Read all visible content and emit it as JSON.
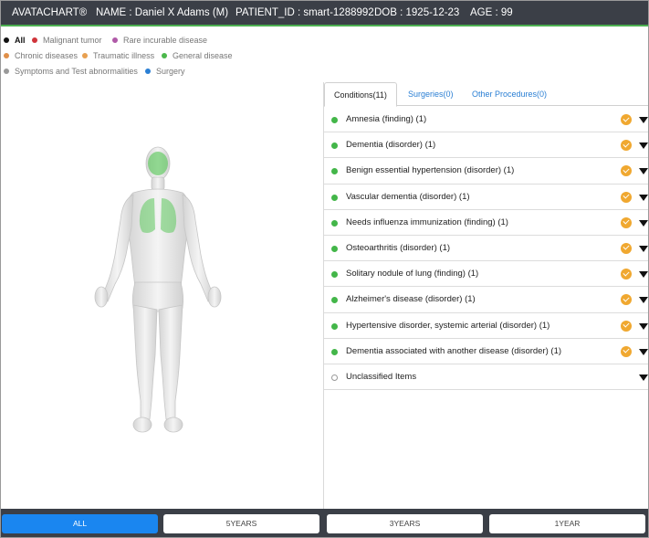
{
  "header": {
    "app_name": "AVATACHART®",
    "name": "NAME : Daniel X Adams (M)",
    "patient_id": "PATIENT_ID : smart-1288992",
    "dob": "DOB : 1925-12-23",
    "age": "AGE : 99",
    "accent_color": "#4caf50"
  },
  "legend": {
    "items": [
      {
        "label": "All",
        "color": "#111111",
        "selected": true
      },
      {
        "label": "Malignant tumor",
        "color": "#d0343a"
      },
      {
        "label": "Rare incurable disease",
        "color": "#b05aa8"
      },
      {
        "label": "Chronic diseases",
        "color": "#e0904a"
      },
      {
        "label": "Traumatic illness",
        "color": "#e8a050"
      },
      {
        "label": "General disease",
        "color": "#4cb84c"
      },
      {
        "label": "Symptoms and Test abnormalities",
        "color": "#9a9a9a"
      },
      {
        "label": "Surgery",
        "color": "#2a7fd4"
      }
    ]
  },
  "tabs": [
    {
      "label": "Conditions(11)",
      "active": true
    },
    {
      "label": "Surgeries(0)",
      "active": false
    },
    {
      "label": "Other Procedures(0)",
      "active": false
    }
  ],
  "conditions": [
    {
      "label": "Amnesia (finding) (1)",
      "status": "general"
    },
    {
      "label": "Dementia (disorder) (1)",
      "status": "general"
    },
    {
      "label": "Benign essential hypertension (disorder) (1)",
      "status": "general"
    },
    {
      "label": "Vascular dementia (disorder) (1)",
      "status": "general"
    },
    {
      "label": "Needs influenza immunization (finding) (1)",
      "status": "general"
    },
    {
      "label": "Osteoarthritis (disorder) (1)",
      "status": "general"
    },
    {
      "label": "Solitary nodule of lung (finding) (1)",
      "status": "general"
    },
    {
      "label": "Alzheimer's disease (disorder) (1)",
      "status": "general"
    },
    {
      "label": "Hypertensive disorder, systemic arterial (disorder) (1)",
      "status": "general"
    },
    {
      "label": "Dementia associated with another disease (disorder) (1)",
      "status": "general"
    },
    {
      "label": "Unclassified Items",
      "status": "unclassified"
    }
  ],
  "footer": {
    "buttons": [
      {
        "label": "ALL",
        "active": true
      },
      {
        "label": "5YEARS",
        "active": false
      },
      {
        "label": "3YEARS",
        "active": false
      },
      {
        "label": "1YEAR",
        "active": false
      }
    ]
  }
}
